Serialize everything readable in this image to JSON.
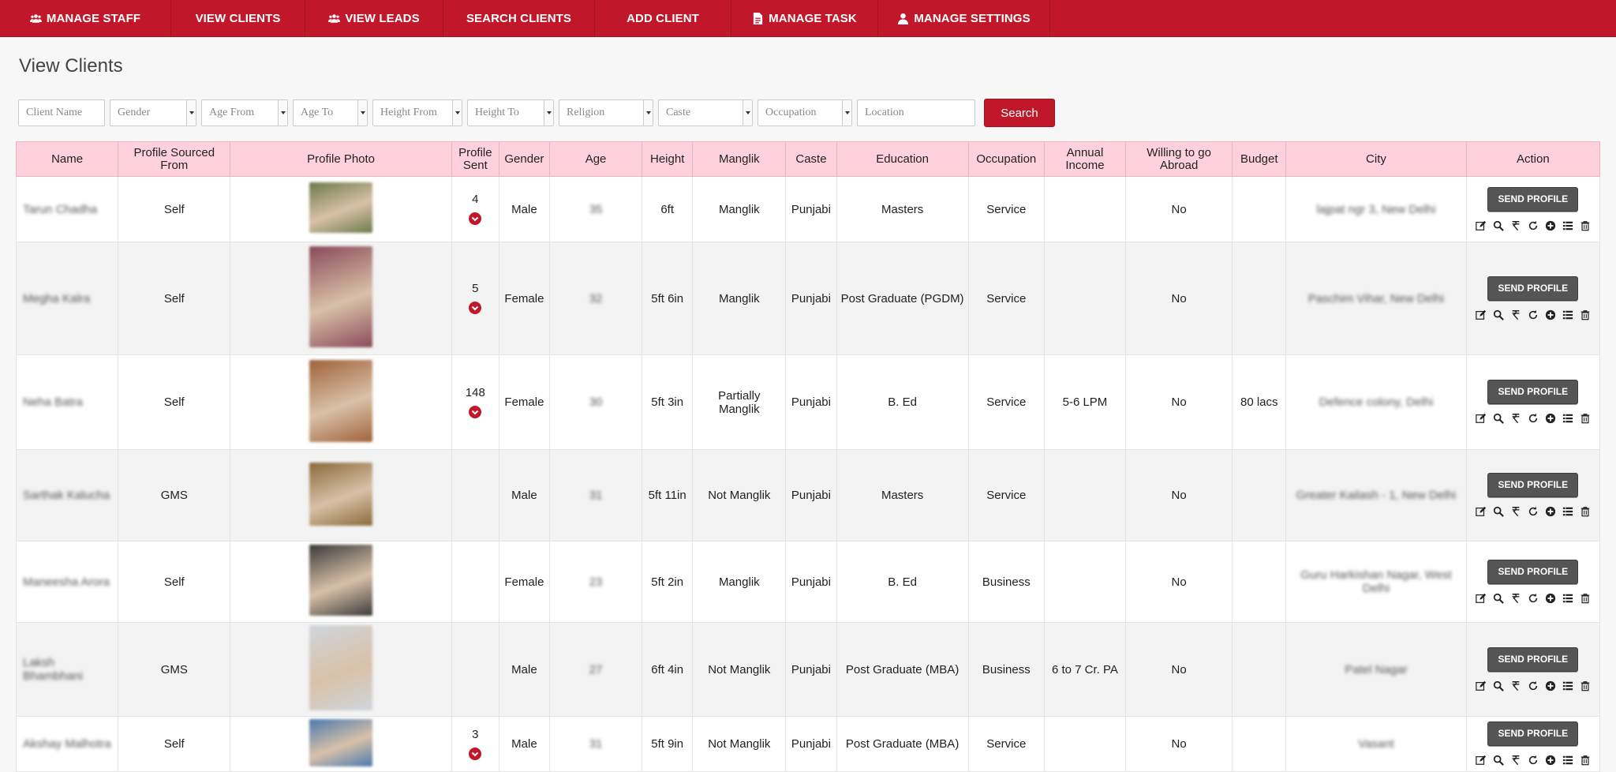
{
  "nav": [
    {
      "label": "MANAGE STAFF",
      "icon": "users-icon"
    },
    {
      "label": "VIEW CLIENTS",
      "icon": ""
    },
    {
      "label": "VIEW LEADS",
      "icon": "users-icon"
    },
    {
      "label": "SEARCH CLIENTS",
      "icon": ""
    },
    {
      "label": "ADD CLIENT",
      "icon": ""
    },
    {
      "label": "MANAGE TASK",
      "icon": "file-icon"
    },
    {
      "label": "MANAGE SETTINGS",
      "icon": "user-icon"
    }
  ],
  "page_title": "View Clients",
  "filters": {
    "client_name_placeholder": "Client Name",
    "gender": "Gender",
    "age_from": "Age From",
    "age_to": "Age To",
    "height_from": "Height From",
    "height_to": "Height To",
    "religion": "Religion",
    "caste": "Caste",
    "occupation": "Occupation",
    "location_placeholder": "Location",
    "search_label": "Search"
  },
  "columns": [
    "Name",
    "Profile Sourced From",
    "Profile Photo",
    "Profile Sent",
    "Gender",
    "Age",
    "Height",
    "Manglik",
    "Caste",
    "Education",
    "Occupation",
    "Annual Income",
    "Willing to go Abroad",
    "Budget",
    "City",
    "Action"
  ],
  "send_profile_label": "SEND PROFILE",
  "rows": [
    {
      "name": "Tarun Chadha",
      "source": "Self",
      "sent": "4",
      "gender": "Male",
      "age": "35",
      "height": "6ft",
      "manglik": "Manglik",
      "caste": "Punjabi",
      "education": "Masters",
      "occupation": "Service",
      "income": "",
      "abroad": "No",
      "budget": "",
      "city": "lajpat ngr 3, New Delhi",
      "photo_color": "#6b7a4a"
    },
    {
      "name": "Megha Kalra",
      "source": "Self",
      "sent": "5",
      "gender": "Female",
      "age": "32",
      "height": "5ft 6in",
      "manglik": "Manglik",
      "caste": "Punjabi",
      "education": "Post Graduate (PGDM)",
      "occupation": "Service",
      "income": "",
      "abroad": "No",
      "budget": "",
      "city": "Paschim Vihar, New Delhi",
      "photo_color": "#8a4a5a"
    },
    {
      "name": "Neha Batra",
      "source": "Self",
      "sent": "148",
      "gender": "Female",
      "age": "30",
      "height": "5ft 3in",
      "manglik": "Partially Manglik",
      "caste": "Punjabi",
      "education": "B. Ed",
      "occupation": "Service",
      "income": "5-6 LPM",
      "abroad": "No",
      "budget": "80 lacs",
      "city": "Defence colony, Delhi",
      "photo_color": "#a0623a"
    },
    {
      "name": "Sarthak Kalucha",
      "source": "GMS",
      "sent": "",
      "gender": "Male",
      "age": "31",
      "height": "5ft 11in",
      "manglik": "Not Manglik",
      "caste": "Punjabi",
      "education": "Masters",
      "occupation": "Service",
      "income": "",
      "abroad": "No",
      "budget": "",
      "city": "Greater Kailash - 1, New Delhi",
      "photo_color": "#8a6a3a"
    },
    {
      "name": "Maneesha Arora",
      "source": "Self",
      "sent": "",
      "gender": "Female",
      "age": "23",
      "height": "5ft 2in",
      "manglik": "Manglik",
      "caste": "Punjabi",
      "education": "B. Ed",
      "occupation": "Business",
      "income": "",
      "abroad": "No",
      "budget": "",
      "city": "Guru Harkishan Nagar, West Delhi",
      "photo_color": "#3a3a3a"
    },
    {
      "name": "Laksh Bhambhani",
      "source": "GMS",
      "sent": "",
      "gender": "Male",
      "age": "27",
      "height": "6ft 4in",
      "manglik": "Not Manglik",
      "caste": "Punjabi",
      "education": "Post Graduate (MBA)",
      "occupation": "Business",
      "income": "6 to 7 Cr. PA",
      "abroad": "No",
      "budget": "",
      "city": "Patel Nagar",
      "photo_color": "#cfd6dc"
    },
    {
      "name": "Akshay Malhotra",
      "source": "Self",
      "sent": "3",
      "gender": "Male",
      "age": "31",
      "height": "5ft 9in",
      "manglik": "Not Manglik",
      "caste": "Punjabi",
      "education": "Post Graduate (MBA)",
      "occupation": "Service",
      "income": "",
      "abroad": "No",
      "budget": "",
      "city": "Vasant",
      "photo_color": "#4a7ab0"
    }
  ]
}
